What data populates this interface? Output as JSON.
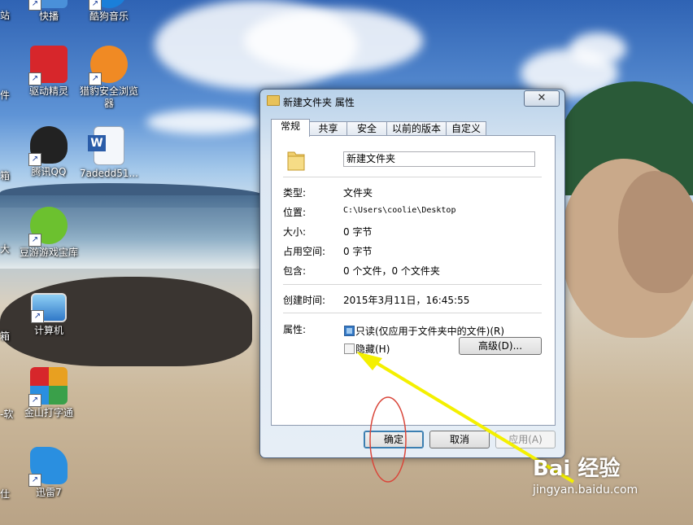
{
  "desktop": {
    "icons": [
      {
        "label": "快播",
        "icon": "qvod-icon",
        "color": "#4a90d9"
      },
      {
        "label": "酷狗音乐",
        "icon": "kugou-icon",
        "color": "#1a7fd9"
      },
      {
        "label": "驱动精灵",
        "icon": "driver-genius-icon",
        "color": "#d7262b"
      },
      {
        "label": "猎豹安全浏览器",
        "icon": "liebao-browser-icon",
        "color": "#f08a24"
      },
      {
        "label": "腾讯QQ",
        "icon": "qq-icon",
        "color": "#222222"
      },
      {
        "label": "7adedd51...",
        "icon": "word-document-icon",
        "color": "#2a5ca8"
      },
      {
        "label": "豆游游戏宝库",
        "icon": "douyou-icon",
        "color": "#6cc12f"
      },
      {
        "label": "计算机",
        "icon": "computer-icon",
        "color": "#3a8fd8"
      },
      {
        "label": "金山打字通",
        "icon": "jinshan-typing-icon",
        "color": "#e8a020"
      },
      {
        "label": "迅雷7",
        "icon": "xunlei-icon",
        "color": "#2a8fe0"
      }
    ],
    "edge_labels": [
      "站",
      "件",
      "箱",
      "大",
      "箱",
      "-软",
      "仕"
    ]
  },
  "dialog": {
    "title": "新建文件夹 属性",
    "close_symbol": "✕",
    "tabs": [
      "常规",
      "共享",
      "安全",
      "以前的版本",
      "自定义"
    ],
    "name_value": "新建文件夹",
    "type_label": "类型:",
    "type_value": "文件夹",
    "location_label": "位置:",
    "location_value": "C:\\Users\\coolie\\Desktop",
    "size_label": "大小:",
    "size_value": "0 字节",
    "disk_size_label": "占用空间:",
    "disk_size_value": "0 字节",
    "contains_label": "包含:",
    "contains_value": "0 个文件，0 个文件夹",
    "created_label": "创建时间:",
    "created_value": "2015年3月11日，16:45:55",
    "attributes_label": "属性:",
    "readonly_label": "只读(仅应用于文件夹中的文件)(R)",
    "hidden_label": "隐藏(H)",
    "advanced_button": "高级(D)...",
    "ok_button": "确定",
    "cancel_button": "取消",
    "apply_button": "应用(A)"
  },
  "watermark": {
    "brand": "Bai 经验",
    "url": "jingyan.baidu.com"
  },
  "annotation_colors": {
    "arrow": "#f4f000",
    "circle": "#d9463a"
  }
}
